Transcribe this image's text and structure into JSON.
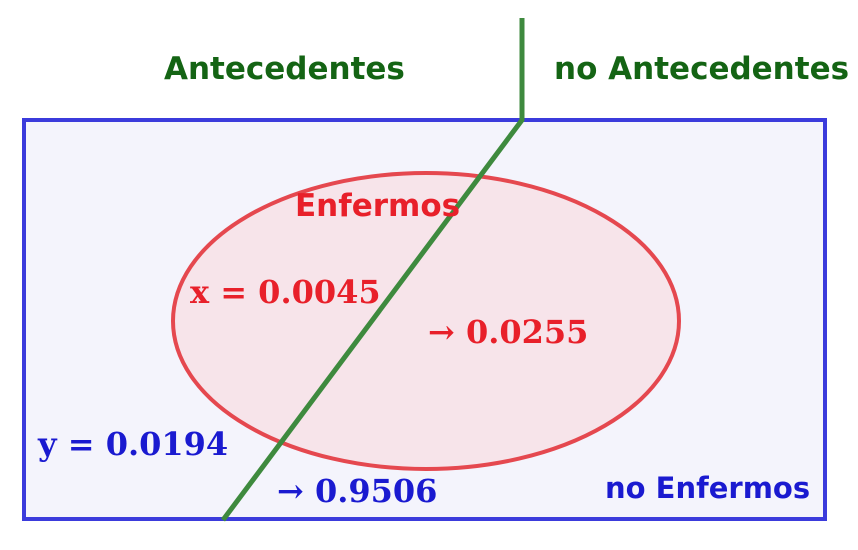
{
  "labels": {
    "antecedentes": "Antecedentes",
    "no_antecedentes": "no Antecedentes",
    "enfermos": "Enfermos",
    "no_enfermos": "no Enfermos"
  },
  "values": {
    "x": "x = 0.0045",
    "enfermos_no_antecedentes": "→ 0.0255",
    "y": "y = 0.0194",
    "no_enfermos_no_antecedentes": "→ 0.9506"
  },
  "colors": {
    "green": "#146414",
    "red": "#e8202a",
    "blue": "#1a1ad0",
    "box_fill": "#f4f4fc",
    "ellipse_fill": "#f7e4ea"
  }
}
